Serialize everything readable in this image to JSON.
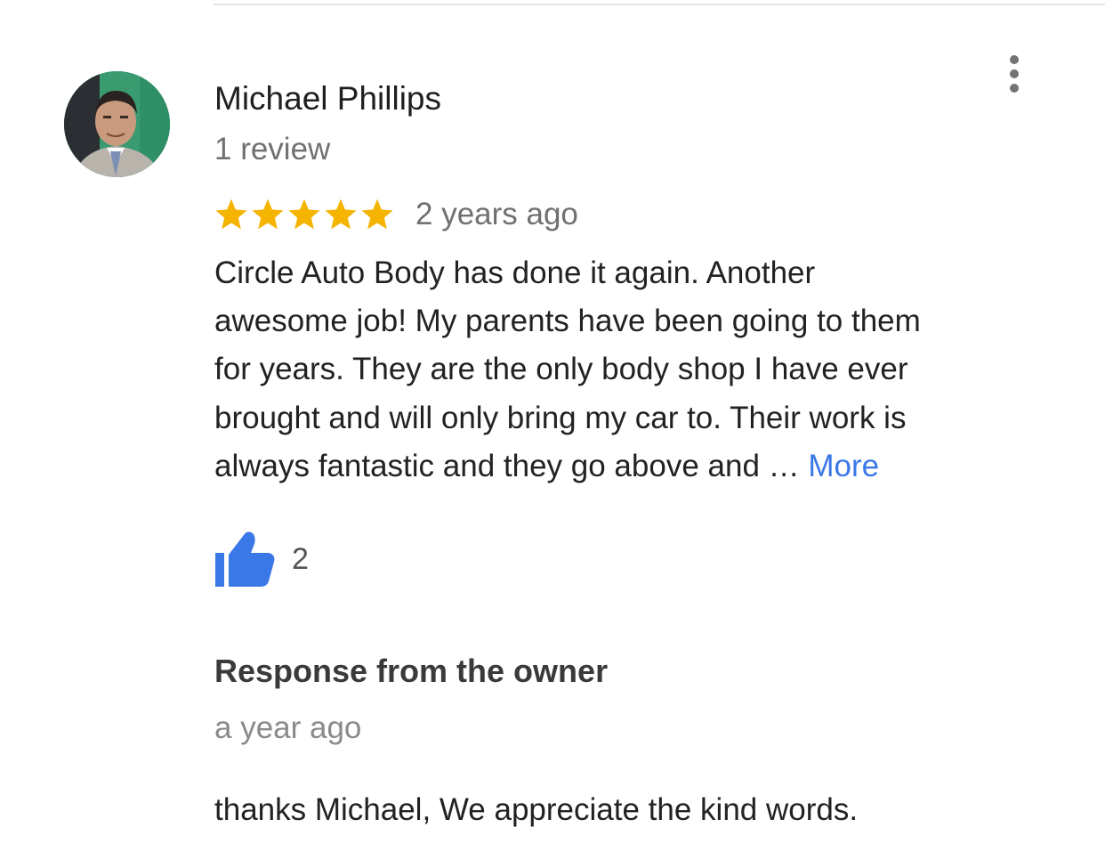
{
  "review": {
    "author_name": "Michael Phillips",
    "author_review_count": "1 review",
    "rating": 5,
    "rating_max": 5,
    "star_color": "#f4b400",
    "time_ago": "2 years ago",
    "text_lines": [
      "Circle Auto Body has done it again. Another",
      "awesome job! My parents have been going to them",
      "for years. They are the only body shop I have ever",
      "brought and will only bring my car to. Their work is",
      "always fantastic and they go above and … "
    ],
    "more_label": "More",
    "link_color": "#3b78e7",
    "like_icon": "thumbs-up-icon",
    "like_color": "#3b78e7",
    "like_count": "2",
    "menu_icon": "more-vert-icon"
  },
  "owner_response": {
    "title": "Response from the owner",
    "time_ago": "a year ago",
    "text": "thanks Michael, We appreciate the kind words."
  }
}
